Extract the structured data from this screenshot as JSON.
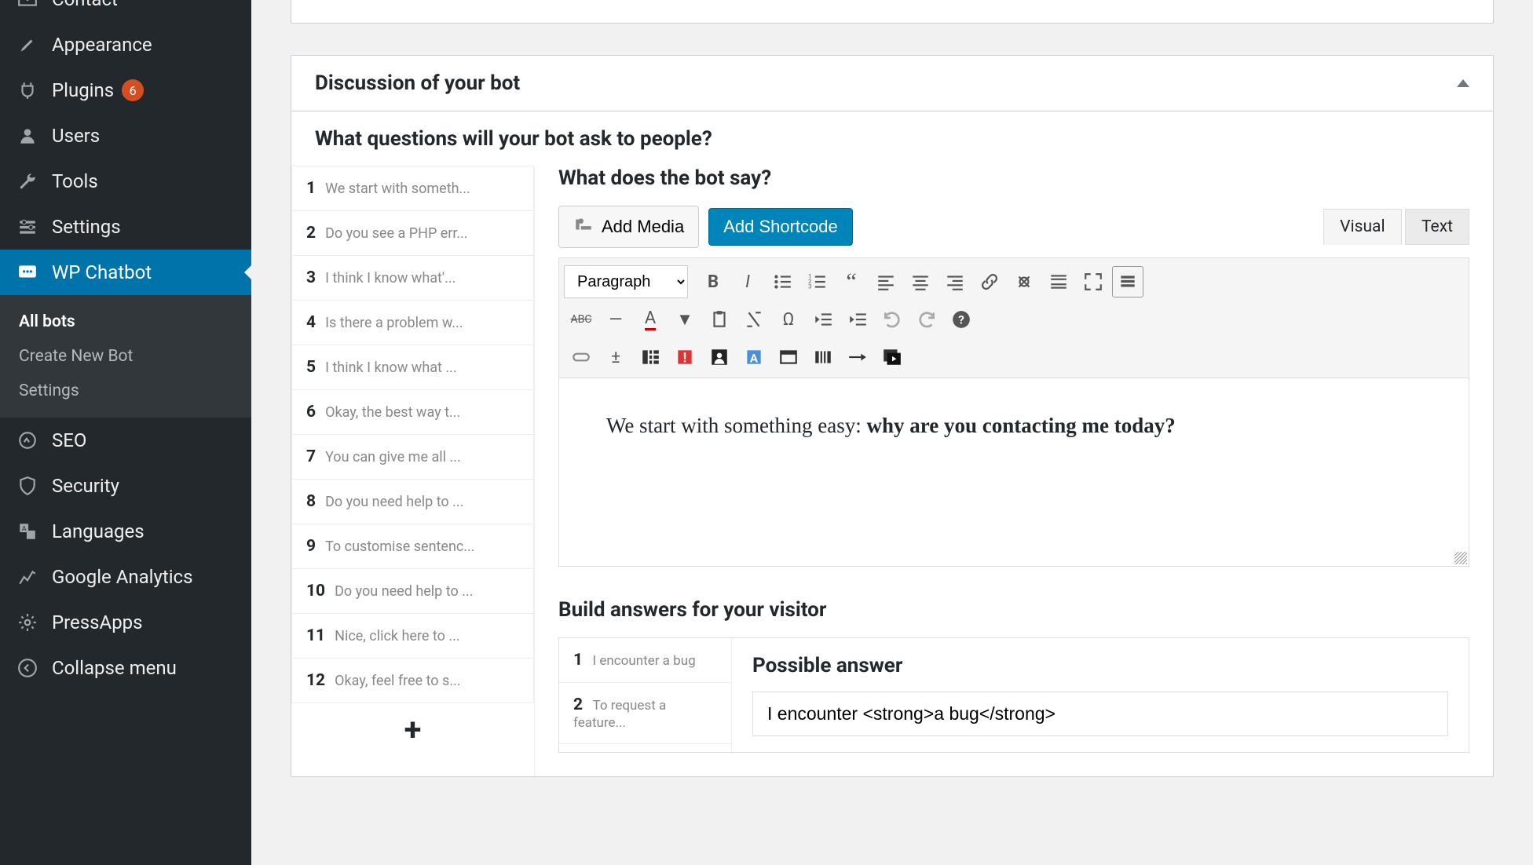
{
  "sidebar": {
    "items": [
      {
        "label": "Contact",
        "icon": "envelope-icon"
      },
      {
        "label": "Appearance",
        "icon": "brush-icon"
      },
      {
        "label": "Plugins",
        "icon": "plugin-icon",
        "badge": "6"
      },
      {
        "label": "Users",
        "icon": "users-icon"
      },
      {
        "label": "Tools",
        "icon": "wrench-icon"
      },
      {
        "label": "Settings",
        "icon": "sliders-icon"
      },
      {
        "label": "WP Chatbot",
        "icon": "chat-icon",
        "active": true
      },
      {
        "label": "SEO",
        "icon": "seo-icon"
      },
      {
        "label": "Security",
        "icon": "shield-icon"
      },
      {
        "label": "Languages",
        "icon": "languages-icon"
      },
      {
        "label": "Google Analytics",
        "icon": "analytics-icon"
      },
      {
        "label": "PressApps",
        "icon": "gear-icon"
      }
    ],
    "submenu": [
      {
        "label": "All bots",
        "current": true
      },
      {
        "label": "Create New Bot"
      },
      {
        "label": "Settings"
      }
    ],
    "collapse": "Collapse menu"
  },
  "panel": {
    "title": "Discussion of your bot",
    "question_heading": "What questions will your bot ask to people?"
  },
  "questions": [
    {
      "n": "1",
      "t": "We start with someth..."
    },
    {
      "n": "2",
      "t": "Do you see a PHP err..."
    },
    {
      "n": "3",
      "t": "I think I know what'..."
    },
    {
      "n": "4",
      "t": "Is there a problem w..."
    },
    {
      "n": "5",
      "t": "I think I know what ..."
    },
    {
      "n": "6",
      "t": "Okay, the best way t..."
    },
    {
      "n": "7",
      "t": "You can give me all ..."
    },
    {
      "n": "8",
      "t": "Do you need help to ..."
    },
    {
      "n": "9",
      "t": "To customise sentenc..."
    },
    {
      "n": "10",
      "t": "Do you need help to ..."
    },
    {
      "n": "11",
      "t": "Nice, click here to ..."
    },
    {
      "n": "12",
      "t": "Okay, feel free to s..."
    }
  ],
  "editor": {
    "heading": "What does the bot say?",
    "add_media": "Add Media",
    "add_shortcode": "Add Shortcode",
    "tab_visual": "Visual",
    "tab_text": "Text",
    "format": "Paragraph",
    "content_plain": "We start with something easy: ",
    "content_bold": "why are you contacting me today?"
  },
  "answers": {
    "heading": "Build answers for your visitor",
    "items": [
      {
        "n": "1",
        "t": "I encounter a bug"
      },
      {
        "n": "2",
        "t": "To request a feature..."
      }
    ],
    "panel_title": "Possible answer",
    "input_value": "I encounter <strong>a bug</strong>"
  }
}
